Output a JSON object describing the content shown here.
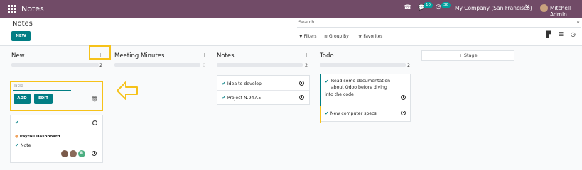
{
  "navbar": {
    "app_title": "Notes",
    "phone_icon": "phone-icon",
    "messages_count": "10",
    "activities_count": "36",
    "company": "My Company (San Francisco)",
    "user": "Mitchell Admin",
    "color": "#714B67"
  },
  "control_panel": {
    "breadcrumb": "Notes",
    "new_label": "NEW",
    "search_placeholder": "Search...",
    "filters_label": "Filters",
    "group_by_label": "Group By",
    "favorites_label": "Favorites",
    "views": [
      "kanban-view-icon",
      "list-view-icon",
      "activity-view-icon"
    ]
  },
  "columns": [
    {
      "title": "New",
      "count": "2"
    },
    {
      "title": "Meeting Minutes",
      "count": "0"
    },
    {
      "title": "Notes",
      "count": "2"
    },
    {
      "title": "Todo",
      "count": "2"
    }
  ],
  "add_stage_label": "Stage",
  "quick_create": {
    "placeholder": "Title",
    "add_label": "ADD",
    "edit_label": "EDIT"
  },
  "new_card": {
    "line1": "Payroll Dashboard",
    "line2": "Note",
    "avatar_initial": "R"
  },
  "notes_cards": [
    {
      "text": "Idea to develop"
    },
    {
      "text": "Project N.947.5"
    }
  ],
  "todo_cards": [
    {
      "text": "Read some documentation about Odoo before diving into the code"
    },
    {
      "text": "New computer specs"
    }
  ],
  "accent_color": "#017e84",
  "highlight_color": "#f6c21a"
}
